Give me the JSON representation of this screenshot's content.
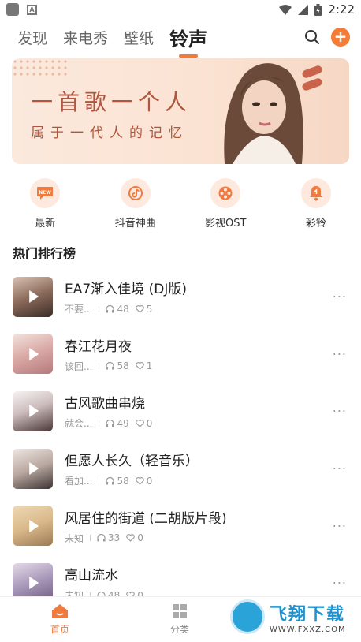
{
  "status_bar": {
    "time": "2:22"
  },
  "top_nav": {
    "tabs": [
      {
        "label": "发现",
        "active": false
      },
      {
        "label": "来电秀",
        "active": false
      },
      {
        "label": "壁纸",
        "active": false
      },
      {
        "label": "铃声",
        "active": true
      }
    ],
    "icons": [
      "search-icon",
      "add-icon"
    ]
  },
  "banner": {
    "title": "一首歌一个人",
    "subtitle": "属于一代人的记忆"
  },
  "categories": [
    {
      "label": "最新",
      "icon": "new-icon",
      "badge": "NEW"
    },
    {
      "label": "抖音神曲",
      "icon": "tiktok-note-icon"
    },
    {
      "label": "影视OST",
      "icon": "film-reel-icon"
    },
    {
      "label": "彩铃",
      "icon": "bell-icon"
    }
  ],
  "section": {
    "title": "热门排行榜"
  },
  "songs": [
    {
      "title": "EA7渐入佳境 (DJ版)",
      "author": "不要...",
      "plays": "48",
      "likes": "5"
    },
    {
      "title": "春江花月夜",
      "author": "该回...",
      "plays": "58",
      "likes": "1"
    },
    {
      "title": "古风歌曲串烧",
      "author": "就会...",
      "plays": "49",
      "likes": "0"
    },
    {
      "title": "但愿人长久（轻音乐）",
      "author": "看加...",
      "plays": "58",
      "likes": "0"
    },
    {
      "title": "风居住的街道 (二胡版片段)",
      "author": "未知",
      "plays": "33",
      "likes": "0"
    },
    {
      "title": "高山流水",
      "author": "未知",
      "plays": "48",
      "likes": "0"
    }
  ],
  "bottom_nav": [
    {
      "label": "首页",
      "icon": "home-icon",
      "active": true
    },
    {
      "label": "分类",
      "icon": "category-grid-icon",
      "active": false
    }
  ],
  "watermark": {
    "title": "飞翔下载",
    "url": "WWW.FXXZ.COM"
  },
  "colors": {
    "accent": "#f07b3f",
    "banner_text": "#b0553e",
    "category_bg": "#fde9de"
  }
}
